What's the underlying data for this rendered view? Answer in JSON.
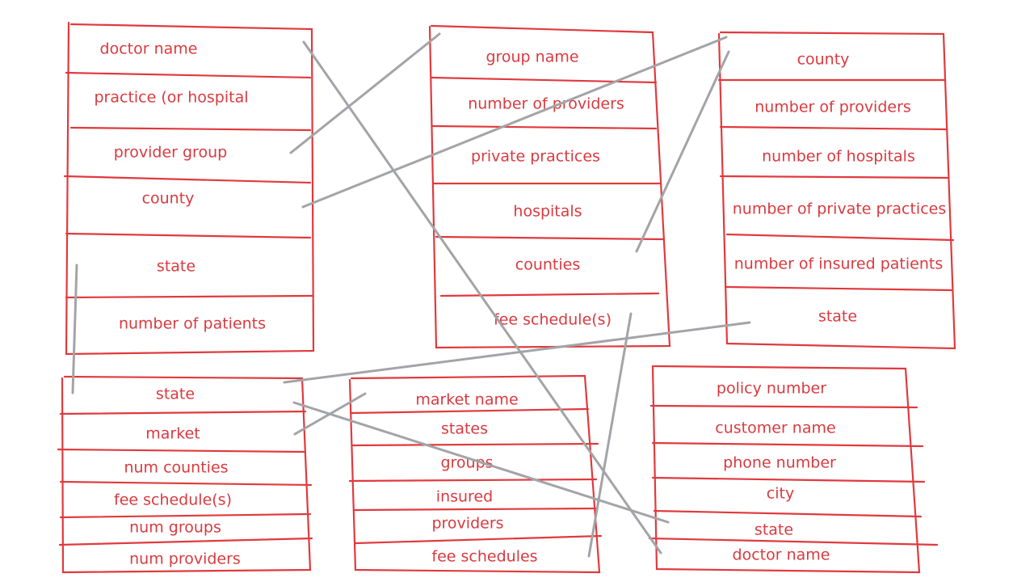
{
  "tables": [
    {
      "id": "doctor",
      "fields": [
        "doctor name",
        "practice (or hospital",
        "provider group",
        "county",
        "state",
        "number of patients"
      ]
    },
    {
      "id": "group",
      "fields": [
        "group name",
        "number of providers",
        "private practices",
        "hospitals",
        "counties",
        "fee schedule(s)"
      ]
    },
    {
      "id": "county",
      "fields": [
        "county",
        "number of providers",
        "number of hospitals",
        "number of private practices",
        "number of insured patients",
        "state"
      ]
    },
    {
      "id": "state",
      "fields": [
        "state",
        "market",
        "num counties",
        "fee schedule(s)",
        "num groups",
        "num providers"
      ]
    },
    {
      "id": "market",
      "fields": [
        "market name",
        "states",
        "groups",
        "insured",
        "providers",
        "fee schedules"
      ]
    },
    {
      "id": "policy",
      "fields": [
        "policy number",
        "customer name",
        "phone number",
        "city",
        "state",
        "doctor name"
      ]
    }
  ],
  "connections": [
    {
      "from": "doctor.provider group",
      "to": "group.group name"
    },
    {
      "from": "doctor.county",
      "to": "county.county"
    },
    {
      "from": "doctor.doctor name",
      "to": "policy.doctor name"
    },
    {
      "from": "doctor.state",
      "to": "state.state"
    },
    {
      "from": "group.counties",
      "to": "county.county"
    },
    {
      "from": "group.fee schedule(s)",
      "to": "market.fee schedules"
    },
    {
      "from": "county.state",
      "to": "state.state"
    },
    {
      "from": "state.state",
      "to": "policy.state"
    },
    {
      "from": "state.market",
      "to": "market.market name"
    }
  ],
  "colors": {
    "box_lines": "#e03a3e",
    "text": "#d93a3f",
    "connectors": "#a3a4a8",
    "background": "#ffffff"
  }
}
